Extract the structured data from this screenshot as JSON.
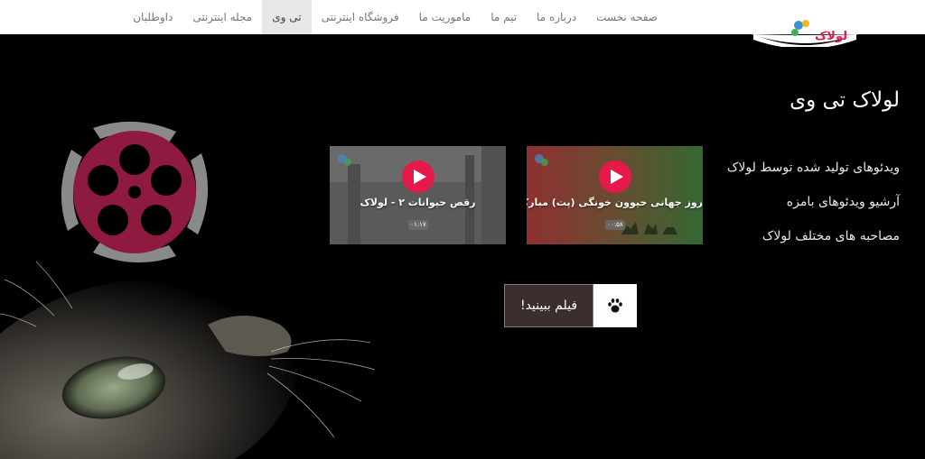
{
  "nav": {
    "items": [
      {
        "label": "صفحه نخست",
        "active": false
      },
      {
        "label": "درباره ما",
        "active": false
      },
      {
        "label": "تیم ما",
        "active": false
      },
      {
        "label": "ماموریت ما",
        "active": false
      },
      {
        "label": "فروشگاه اینترنتی",
        "active": false
      },
      {
        "label": "تی وی",
        "active": true
      },
      {
        "label": "مجله اینترنتی",
        "active": false
      },
      {
        "label": "داوطلبان",
        "active": false
      }
    ]
  },
  "logo": {
    "text": "لولاک"
  },
  "hero": {
    "title": "لولاک تی وی",
    "features": [
      "ویدئوهای تولید شده توسط لولاک",
      "آرشیو ویدئوهای بامزه",
      "مصاحبه های مختلف لولاک"
    ]
  },
  "videos": [
    {
      "title": "روز جهانی حیوون خونگی (پت) مبارک!",
      "duration": "۰۰:۵۸"
    },
    {
      "title": "رقص حیوانات ۲ - لولاک",
      "duration": "۰۱:۱۷"
    }
  ],
  "cta": {
    "label": "فیلم ببینید!",
    "icon": "paw-icon"
  },
  "colors": {
    "accent": "#e6194b",
    "reel": "#8e1a40",
    "cta_bg": "#3a2e2e"
  }
}
